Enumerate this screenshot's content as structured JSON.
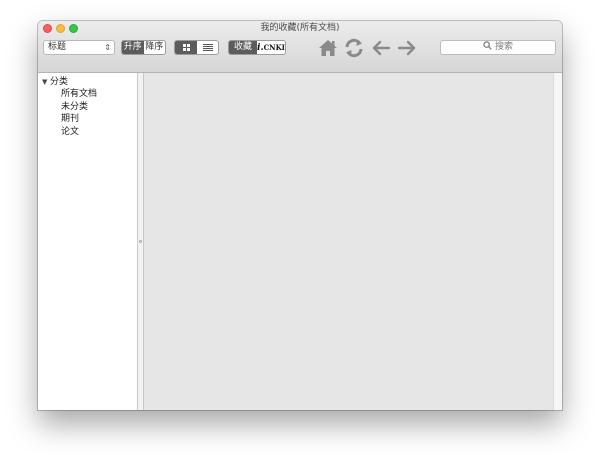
{
  "window": {
    "title": "我的收藏(所有文档)"
  },
  "toolbar": {
    "sort_field": "标题",
    "order": {
      "ascending": "升序",
      "descending": "降序",
      "selected": "ascending"
    },
    "view_mode": {
      "options": [
        "grid-view",
        "list-view"
      ],
      "selected": "grid-view"
    },
    "source": {
      "favorites": "收藏",
      "cnki_prefix": "i.",
      "cnki": "CNKI",
      "selected": "favorites"
    },
    "nav_icons": [
      "home-icon",
      "refresh-icon",
      "back-arrow-icon",
      "forward-arrow-icon"
    ],
    "search_placeholder": "搜索"
  },
  "sidebar": {
    "root": {
      "label": "分类",
      "expanded": true,
      "children": [
        "所有文档",
        "未分类",
        "期刊",
        "论文"
      ]
    }
  },
  "colors": {
    "toolbar_top": "#ececec",
    "toolbar_bottom": "#d6d6d6",
    "segment_selected": "#5c5c5c",
    "content_background": "#e6e6e6",
    "close": "#fc605b",
    "minimize": "#fdbc40",
    "maximize": "#34c84a"
  }
}
